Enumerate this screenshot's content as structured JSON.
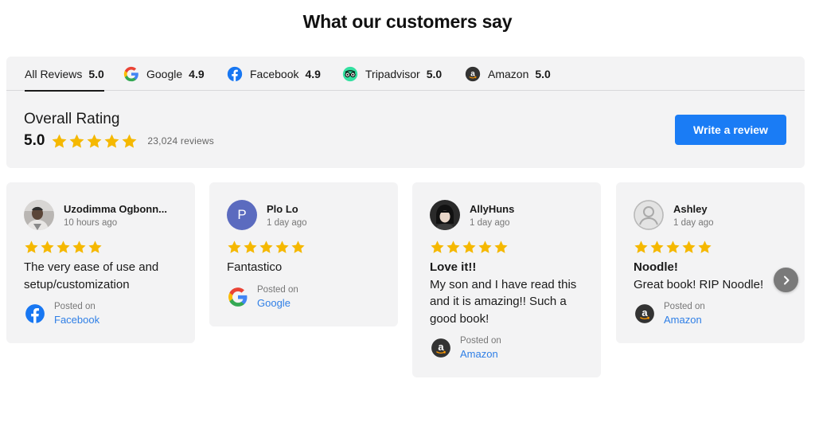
{
  "page": {
    "title": "What our customers say"
  },
  "colors": {
    "accent": "#1a7cf5",
    "star": "#f5b800",
    "link": "#2f7fe6",
    "panel": "#f3f3f4"
  },
  "tabs": [
    {
      "label": "All Reviews",
      "score": "5.0",
      "icon": "none",
      "active": true
    },
    {
      "label": "Google",
      "score": "4.9",
      "icon": "google-icon"
    },
    {
      "label": "Facebook",
      "score": "4.9",
      "icon": "facebook-icon"
    },
    {
      "label": "Tripadvisor",
      "score": "5.0",
      "icon": "tripadvisor-icon"
    },
    {
      "label": "Amazon",
      "score": "5.0",
      "icon": "amazon-icon"
    }
  ],
  "overall": {
    "label": "Overall Rating",
    "score": "5.0",
    "stars": 5,
    "count": "23,024",
    "count_suffix": "reviews",
    "write_button": "Write a review"
  },
  "reviews": [
    {
      "name": "Uzodimma Ogbonn...",
      "time": "10 hours ago",
      "stars": 5,
      "headline": "",
      "text": "The very ease of use and setup/customization",
      "posted_on": "Posted on",
      "source": "Facebook",
      "avatar": "photo"
    },
    {
      "name": "Plo Lo",
      "time": "1 day ago",
      "stars": 5,
      "headline": "",
      "text": "Fantastico",
      "posted_on": "Posted on",
      "source": "Google",
      "avatar": "letter",
      "avatar_letter": "P"
    },
    {
      "name": "AllyHuns",
      "time": "1 day ago",
      "stars": 5,
      "headline": "Love it!!",
      "text": "My son and I have read this and it is amazing!! Such a good book!",
      "posted_on": "Posted on",
      "source": "Amazon",
      "avatar": "photo"
    },
    {
      "name": "Ashley",
      "time": "1 day ago",
      "stars": 5,
      "headline": "Noodle!",
      "text": "Great book! RIP Noodle!",
      "posted_on": "Posted on",
      "source": "Amazon",
      "avatar": "placeholder"
    }
  ],
  "carousel": {
    "next_icon": "chevron-right-icon"
  }
}
